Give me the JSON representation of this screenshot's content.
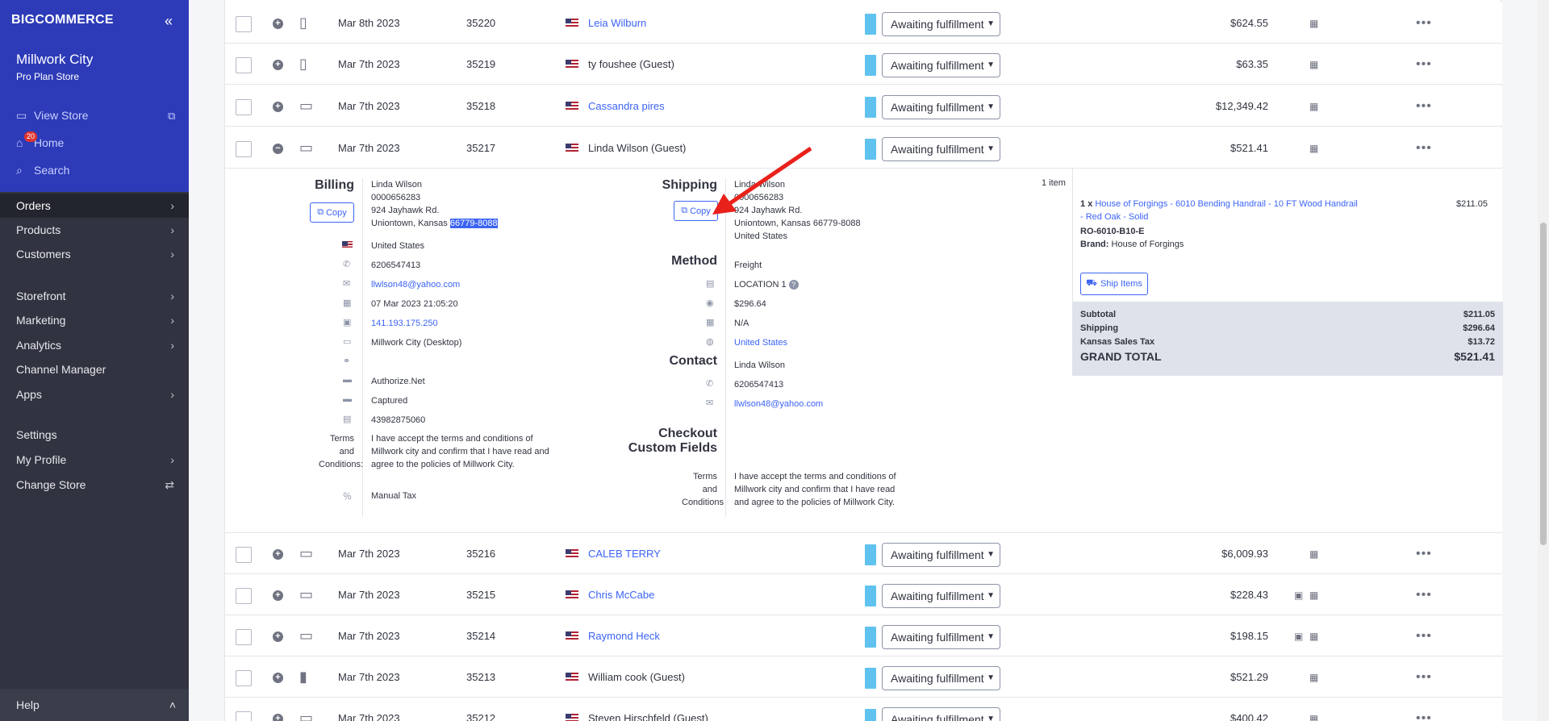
{
  "sidebar": {
    "logo": "BIGCOMMERCE",
    "store_name": "Millwork City",
    "store_plan": "Pro Plan Store",
    "view_store": "View Store",
    "home": "Home",
    "home_badge": "20",
    "search": "Search",
    "nav": [
      "Orders",
      "Products",
      "Customers",
      "Storefront",
      "Marketing",
      "Analytics",
      "Channel Manager",
      "Apps",
      "Settings",
      "My Profile",
      "Change Store"
    ],
    "help": "Help"
  },
  "orders": [
    {
      "date": "Mar 8th 2023",
      "id": "35220",
      "customer": "Leia Wilburn",
      "status": "Awaiting fulfillment",
      "total": "$624.55"
    },
    {
      "date": "Mar 7th 2023",
      "id": "35219",
      "customer": "ty foushee (Guest)",
      "status": "Awaiting fulfillment",
      "total": "$63.35"
    },
    {
      "date": "Mar 7th 2023",
      "id": "35218",
      "customer": "Cassandra pires",
      "status": "Awaiting fulfillment",
      "total": "$12,349.42"
    },
    {
      "date": "Mar 7th 2023",
      "id": "35217",
      "customer": "Linda Wilson (Guest)",
      "status": "Awaiting fulfillment",
      "total": "$521.41"
    },
    {
      "date": "Mar 7th 2023",
      "id": "35216",
      "customer": "CALEB TERRY",
      "status": "Awaiting fulfillment",
      "total": "$6,009.93"
    },
    {
      "date": "Mar 7th 2023",
      "id": "35215",
      "customer": "Chris McCabe",
      "status": "Awaiting fulfillment",
      "total": "$228.43"
    },
    {
      "date": "Mar 7th 2023",
      "id": "35214",
      "customer": "Raymond Heck",
      "status": "Awaiting fulfillment",
      "total": "$198.15"
    },
    {
      "date": "Mar 7th 2023",
      "id": "35213",
      "customer": "William cook (Guest)",
      "status": "Awaiting fulfillment",
      "total": "$521.29"
    },
    {
      "date": "Mar 7th 2023",
      "id": "35212",
      "customer": "Steven Hirschfeld (Guest)",
      "status": "Awaiting fulfillment",
      "total": "$400.42"
    }
  ],
  "detail": {
    "billing_title": "Billing",
    "copy": "Copy",
    "billing": {
      "name": "Linda Wilson",
      "phone_line": "0000656283",
      "street": "924 Jayhawk Rd.",
      "city": "Uniontown, Kansas",
      "zip": "66779-8088",
      "country": "United States",
      "phone": "6206547413",
      "email": "llwlson48@yahoo.com",
      "date": "07 Mar 2023 21:05:20",
      "ip": "141.193.175.250",
      "channel": "Millwork City (Desktop)",
      "gateway": "Authorize.Net",
      "payment_status": "Captured",
      "transaction": "43982875060",
      "terms_label": "Terms and Conditions:",
      "terms_text": "I have accept the terms and conditions of Millwork city and confirm that I have read and agree to the policies of Millwork City.",
      "tax": "Manual Tax"
    },
    "shipping_title": "Shipping",
    "shipping": {
      "name": "Linda Wilson",
      "phone_line": "0000656283",
      "street": "924 Jayhawk Rd.",
      "city": "Uniontown, Kansas 66779-8088",
      "country": "United States"
    },
    "method_title": "Method",
    "method": {
      "type": "Freight",
      "location": "LOCATION 1",
      "cost": "$296.64",
      "date": "N/A",
      "country": "United States"
    },
    "contact_title": "Contact",
    "contact": {
      "name": "Linda Wilson",
      "phone": "6206547413",
      "email": "llwlson48@yahoo.com"
    },
    "custom_title_1": "Checkout",
    "custom_title_2": "Custom Fields",
    "custom": {
      "terms_label": "Terms and Conditions",
      "terms_text": "I have accept the terms and conditions of Millwork city and confirm that I have read and agree to the policies of Millwork City."
    },
    "items_count": "1 item",
    "item": {
      "qty": "1 x",
      "name": "House of Forgings - 6010 Bending Handrail - 10 FT Wood Handrail - Red Oak - Solid",
      "price": "$211.05",
      "sku": "RO-6010-B10-E",
      "brand_label": "Brand:",
      "brand": "House of Forgings"
    },
    "ship_items": "Ship Items",
    "summary": {
      "subtotal_label": "Subtotal",
      "subtotal": "$211.05",
      "shipping_label": "Shipping",
      "shipping": "$296.64",
      "tax_label": "Kansas Sales Tax",
      "tax": "$13.72",
      "grand_label": "GRAND TOTAL",
      "grand": "$521.41"
    }
  }
}
